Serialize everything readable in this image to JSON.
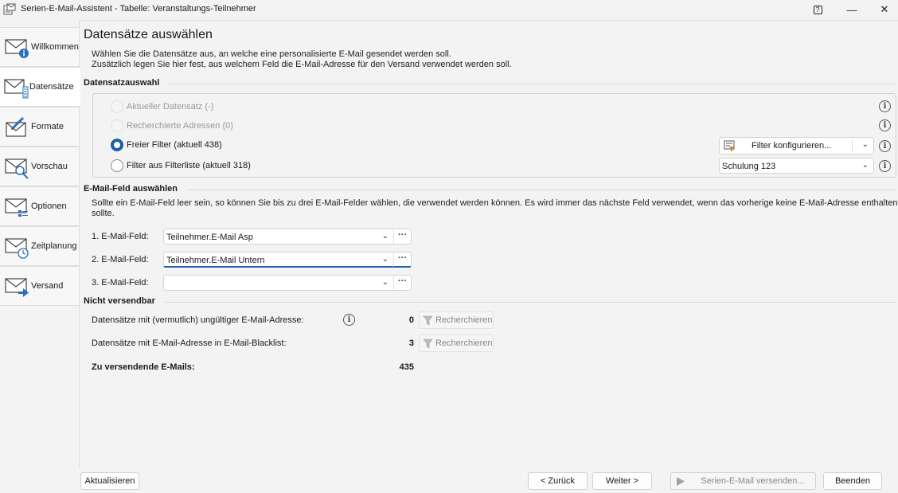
{
  "window": {
    "title": "Serien-E-Mail-Assistent - Tabelle: Veranstaltungs-Teilnehmer",
    "help_label": "?",
    "minimize_label": "—",
    "close_label": "✕"
  },
  "sidebar": {
    "items": [
      {
        "label": "Willkommen",
        "icon": "envelope-info-icon"
      },
      {
        "label": "Datensätze",
        "icon": "envelope-list-icon"
      },
      {
        "label": "Formate",
        "icon": "envelope-pen-icon"
      },
      {
        "label": "Vorschau",
        "icon": "envelope-magnifier-icon"
      },
      {
        "label": "Optionen",
        "icon": "envelope-options-icon"
      },
      {
        "label": "Zeitplanung",
        "icon": "envelope-clock-icon"
      },
      {
        "label": "Versand",
        "icon": "envelope-arrow-icon"
      }
    ],
    "active_index": 1
  },
  "main": {
    "title": "Datensätze auswählen",
    "description_line1": "Wählen Sie die Datensätze aus, an welche eine personalisierte E-Mail gesendet werden soll.",
    "description_line2": "Zusätzlich legen Sie hier fest, aus welchem Feld die E-Mail-Adresse für den Versand verwendet werden soll."
  },
  "selection": {
    "heading": "Datensatzauswahl",
    "options": [
      {
        "label": "Aktueller Datensatz (-)",
        "state": "disabled"
      },
      {
        "label": "Recherchierte Adressen (0)",
        "state": "disabled"
      },
      {
        "label": "Freier Filter (aktuell 438)",
        "state": "checked"
      },
      {
        "label": "Filter aus Filterliste (aktuell 318)",
        "state": "unchecked"
      }
    ],
    "filter_button_label": "Filter konfigurieren...",
    "filter_list_value": "Schulung 123",
    "info_symbol": "i"
  },
  "email_fields": {
    "heading": "E-Mail-Feld auswählen",
    "description_line1": "Sollte ein E-Mail-Feld leer sein, so können Sie bis zu drei E-Mail-Felder wählen, die verwendet werden können. Es wird immer das nächste Feld verwendet, wenn das vorherige keine E-Mail-Adresse enthalten",
    "description_line2": "sollte.",
    "fields": [
      {
        "label": "1. E-Mail-Feld:",
        "value": "Teilnehmer.E-Mail Asp"
      },
      {
        "label": "2. E-Mail-Feld:",
        "value": "Teilnehmer.E-Mail Untern"
      },
      {
        "label": "3. E-Mail-Feld:",
        "value": ""
      }
    ],
    "dots_label": "···"
  },
  "not_sendable": {
    "heading": "Nicht versendbar",
    "rows": [
      {
        "label": "Datensätze mit (vermutlich) ungültiger E-Mail-Adresse:",
        "value": "0",
        "button": "Recherchieren"
      },
      {
        "label": "Datensätze mit E-Mail-Adresse in E-Mail-Blacklist:",
        "value": "3",
        "button": "Recherchieren"
      }
    ],
    "total_label": "Zu versendende E-Mails:",
    "total_value": "435"
  },
  "footer": {
    "refresh_label": "Aktualisieren",
    "back_label": "< Zurück",
    "next_label": "Weiter >",
    "send_label": "Serien-E-Mail versenden...",
    "finish_label": "Beenden"
  },
  "colors": {
    "accent": "#1b5fa8",
    "background": "#f3f3f3"
  }
}
